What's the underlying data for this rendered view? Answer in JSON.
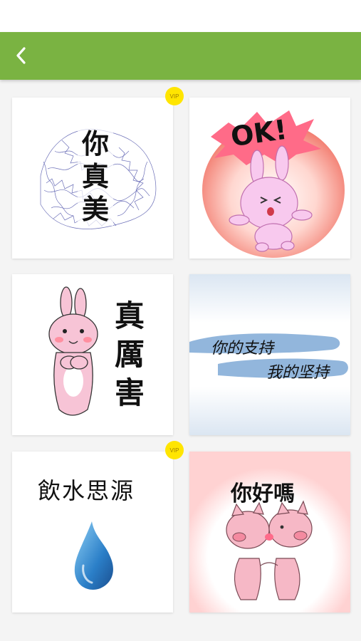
{
  "colors": {
    "app_bar": "#7ab342",
    "vip_badge": "#ffe500",
    "background": "#f4f4f4"
  },
  "header": {
    "back_icon": "chevron-left-icon"
  },
  "stickers": [
    {
      "id": "sticker-1",
      "vip": "VIP",
      "text": "你真美"
    },
    {
      "id": "sticker-2",
      "vip": "",
      "text": "OK!"
    },
    {
      "id": "sticker-3",
      "vip": "",
      "text": "真厲害"
    },
    {
      "id": "sticker-4",
      "vip": "",
      "line1": "你的支持",
      "line2": "我的坚持"
    },
    {
      "id": "sticker-5",
      "vip": "VIP",
      "text": "飲水思源"
    },
    {
      "id": "sticker-6",
      "vip": "",
      "text": "你好嗎"
    }
  ]
}
